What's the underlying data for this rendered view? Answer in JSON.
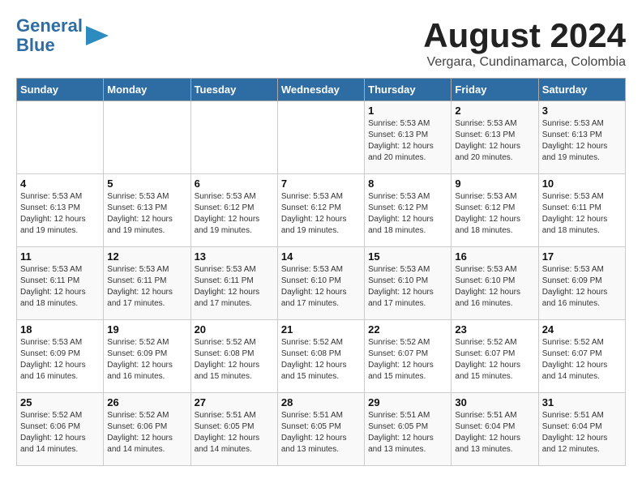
{
  "header": {
    "logo_line1": "General",
    "logo_line2": "Blue",
    "month_title": "August 2024",
    "subtitle": "Vergara, Cundinamarca, Colombia"
  },
  "weekdays": [
    "Sunday",
    "Monday",
    "Tuesday",
    "Wednesday",
    "Thursday",
    "Friday",
    "Saturday"
  ],
  "weeks": [
    [
      {
        "day": "",
        "info": ""
      },
      {
        "day": "",
        "info": ""
      },
      {
        "day": "",
        "info": ""
      },
      {
        "day": "",
        "info": ""
      },
      {
        "day": "1",
        "info": "Sunrise: 5:53 AM\nSunset: 6:13 PM\nDaylight: 12 hours\nand 20 minutes."
      },
      {
        "day": "2",
        "info": "Sunrise: 5:53 AM\nSunset: 6:13 PM\nDaylight: 12 hours\nand 20 minutes."
      },
      {
        "day": "3",
        "info": "Sunrise: 5:53 AM\nSunset: 6:13 PM\nDaylight: 12 hours\nand 19 minutes."
      }
    ],
    [
      {
        "day": "4",
        "info": "Sunrise: 5:53 AM\nSunset: 6:13 PM\nDaylight: 12 hours\nand 19 minutes."
      },
      {
        "day": "5",
        "info": "Sunrise: 5:53 AM\nSunset: 6:13 PM\nDaylight: 12 hours\nand 19 minutes."
      },
      {
        "day": "6",
        "info": "Sunrise: 5:53 AM\nSunset: 6:12 PM\nDaylight: 12 hours\nand 19 minutes."
      },
      {
        "day": "7",
        "info": "Sunrise: 5:53 AM\nSunset: 6:12 PM\nDaylight: 12 hours\nand 19 minutes."
      },
      {
        "day": "8",
        "info": "Sunrise: 5:53 AM\nSunset: 6:12 PM\nDaylight: 12 hours\nand 18 minutes."
      },
      {
        "day": "9",
        "info": "Sunrise: 5:53 AM\nSunset: 6:12 PM\nDaylight: 12 hours\nand 18 minutes."
      },
      {
        "day": "10",
        "info": "Sunrise: 5:53 AM\nSunset: 6:11 PM\nDaylight: 12 hours\nand 18 minutes."
      }
    ],
    [
      {
        "day": "11",
        "info": "Sunrise: 5:53 AM\nSunset: 6:11 PM\nDaylight: 12 hours\nand 18 minutes."
      },
      {
        "day": "12",
        "info": "Sunrise: 5:53 AM\nSunset: 6:11 PM\nDaylight: 12 hours\nand 17 minutes."
      },
      {
        "day": "13",
        "info": "Sunrise: 5:53 AM\nSunset: 6:11 PM\nDaylight: 12 hours\nand 17 minutes."
      },
      {
        "day": "14",
        "info": "Sunrise: 5:53 AM\nSunset: 6:10 PM\nDaylight: 12 hours\nand 17 minutes."
      },
      {
        "day": "15",
        "info": "Sunrise: 5:53 AM\nSunset: 6:10 PM\nDaylight: 12 hours\nand 17 minutes."
      },
      {
        "day": "16",
        "info": "Sunrise: 5:53 AM\nSunset: 6:10 PM\nDaylight: 12 hours\nand 16 minutes."
      },
      {
        "day": "17",
        "info": "Sunrise: 5:53 AM\nSunset: 6:09 PM\nDaylight: 12 hours\nand 16 minutes."
      }
    ],
    [
      {
        "day": "18",
        "info": "Sunrise: 5:53 AM\nSunset: 6:09 PM\nDaylight: 12 hours\nand 16 minutes."
      },
      {
        "day": "19",
        "info": "Sunrise: 5:52 AM\nSunset: 6:09 PM\nDaylight: 12 hours\nand 16 minutes."
      },
      {
        "day": "20",
        "info": "Sunrise: 5:52 AM\nSunset: 6:08 PM\nDaylight: 12 hours\nand 15 minutes."
      },
      {
        "day": "21",
        "info": "Sunrise: 5:52 AM\nSunset: 6:08 PM\nDaylight: 12 hours\nand 15 minutes."
      },
      {
        "day": "22",
        "info": "Sunrise: 5:52 AM\nSunset: 6:07 PM\nDaylight: 12 hours\nand 15 minutes."
      },
      {
        "day": "23",
        "info": "Sunrise: 5:52 AM\nSunset: 6:07 PM\nDaylight: 12 hours\nand 15 minutes."
      },
      {
        "day": "24",
        "info": "Sunrise: 5:52 AM\nSunset: 6:07 PM\nDaylight: 12 hours\nand 14 minutes."
      }
    ],
    [
      {
        "day": "25",
        "info": "Sunrise: 5:52 AM\nSunset: 6:06 PM\nDaylight: 12 hours\nand 14 minutes."
      },
      {
        "day": "26",
        "info": "Sunrise: 5:52 AM\nSunset: 6:06 PM\nDaylight: 12 hours\nand 14 minutes."
      },
      {
        "day": "27",
        "info": "Sunrise: 5:51 AM\nSunset: 6:05 PM\nDaylight: 12 hours\nand 14 minutes."
      },
      {
        "day": "28",
        "info": "Sunrise: 5:51 AM\nSunset: 6:05 PM\nDaylight: 12 hours\nand 13 minutes."
      },
      {
        "day": "29",
        "info": "Sunrise: 5:51 AM\nSunset: 6:05 PM\nDaylight: 12 hours\nand 13 minutes."
      },
      {
        "day": "30",
        "info": "Sunrise: 5:51 AM\nSunset: 6:04 PM\nDaylight: 12 hours\nand 13 minutes."
      },
      {
        "day": "31",
        "info": "Sunrise: 5:51 AM\nSunset: 6:04 PM\nDaylight: 12 hours\nand 12 minutes."
      }
    ]
  ]
}
